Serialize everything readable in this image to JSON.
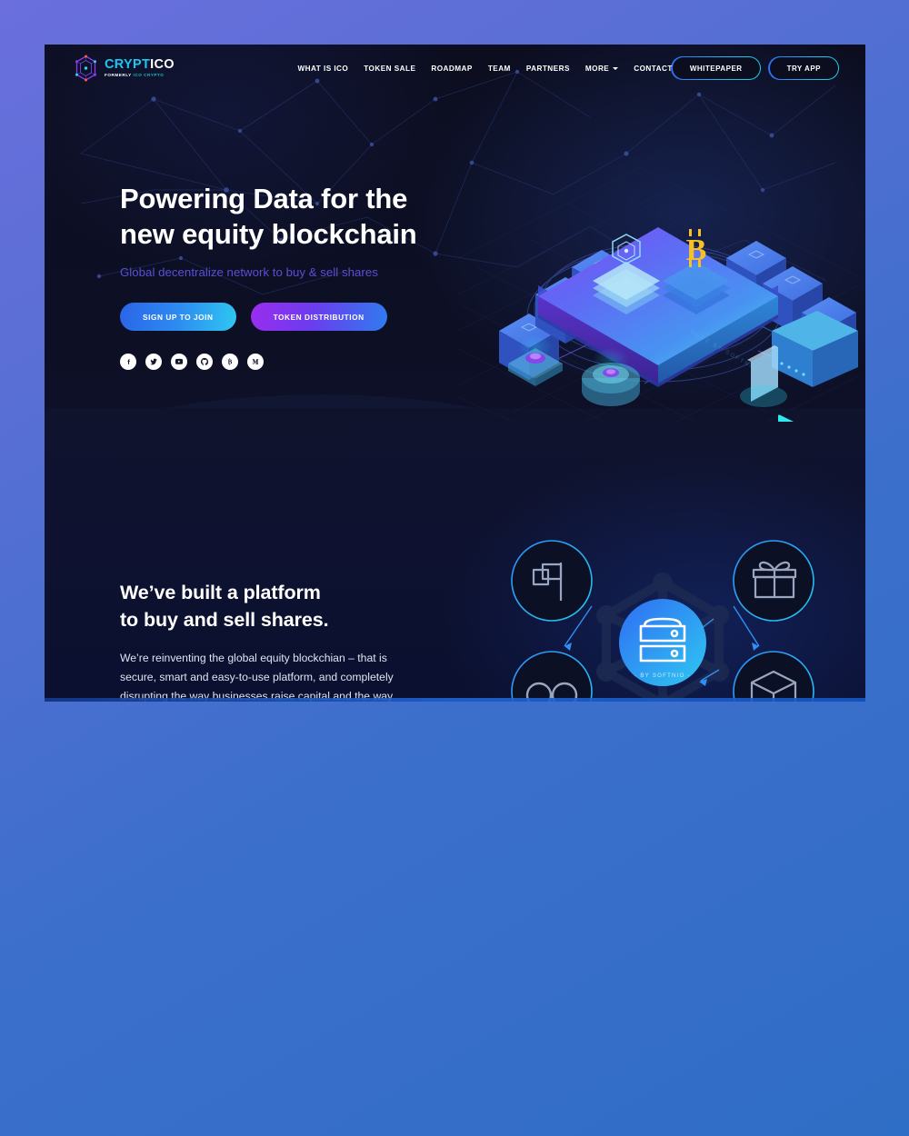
{
  "brand": {
    "name_part1": "CRYPT",
    "name_part2": "ICO",
    "tagline_part1": "FORMERLY",
    "tagline_part2": "ICO CRYPTO",
    "logo_icon": "hexagon-node-logo-icon"
  },
  "nav": {
    "links": [
      {
        "label": "WHAT IS ICO",
        "name": "nav-what-is-ico"
      },
      {
        "label": "TOKEN SALE",
        "name": "nav-token-sale"
      },
      {
        "label": "ROADMAP",
        "name": "nav-roadmap"
      },
      {
        "label": "TEAM",
        "name": "nav-team"
      },
      {
        "label": "PARTNERS",
        "name": "nav-partners"
      },
      {
        "label": "MORE",
        "name": "nav-more",
        "has_caret": true
      },
      {
        "label": "CONTACT",
        "name": "nav-contact"
      }
    ],
    "whitepaper_label": "WHITEPAPER",
    "tryapp_label": "TRY APP"
  },
  "hero": {
    "title_line1": "Powering Data for the",
    "title_line2": "new equity blockchain",
    "subtitle": "Global decentralize network to buy & sell shares",
    "cta_primary": "SIGN UP TO JOIN",
    "cta_secondary": "TOKEN DISTRIBUTION",
    "socials": [
      {
        "name": "facebook-icon",
        "glyph": "facebook"
      },
      {
        "name": "twitter-icon",
        "glyph": "twitter"
      },
      {
        "name": "youtube-icon",
        "glyph": "youtube"
      },
      {
        "name": "github-icon",
        "glyph": "github"
      },
      {
        "name": "bitcointalk-icon",
        "glyph": "bitcoin"
      },
      {
        "name": "medium-icon",
        "glyph": "medium"
      }
    ],
    "illustration": "isometric-blockchain-platform-illustration"
  },
  "section2": {
    "title_line1": "We’ve built a platform",
    "title_line2": "to buy and sell shares.",
    "body_line1": "We’re reinventing the global equity blockchian – that is",
    "body_line2": "secure, smart and easy-to-use platform, and completely",
    "body_line3": "disrupting the way businesses raise capital and the way",
    "center_caption": "· BY SOFTNIO ·",
    "nodes": [
      {
        "name": "flag-icon",
        "label": "flag"
      },
      {
        "name": "gift-icon",
        "label": "gift"
      },
      {
        "name": "infinity-icon",
        "label": "infinity"
      },
      {
        "name": "box-icon",
        "label": "box"
      }
    ],
    "center_node": {
      "name": "server-icon",
      "label": "server"
    }
  },
  "colors": {
    "page_bg": "#0c0e20",
    "accent_cyan": "#1fc6f4",
    "accent_blue": "#2f6df3",
    "accent_purple": "#5a4fd6",
    "outer_bg": "#5b6fd6"
  }
}
